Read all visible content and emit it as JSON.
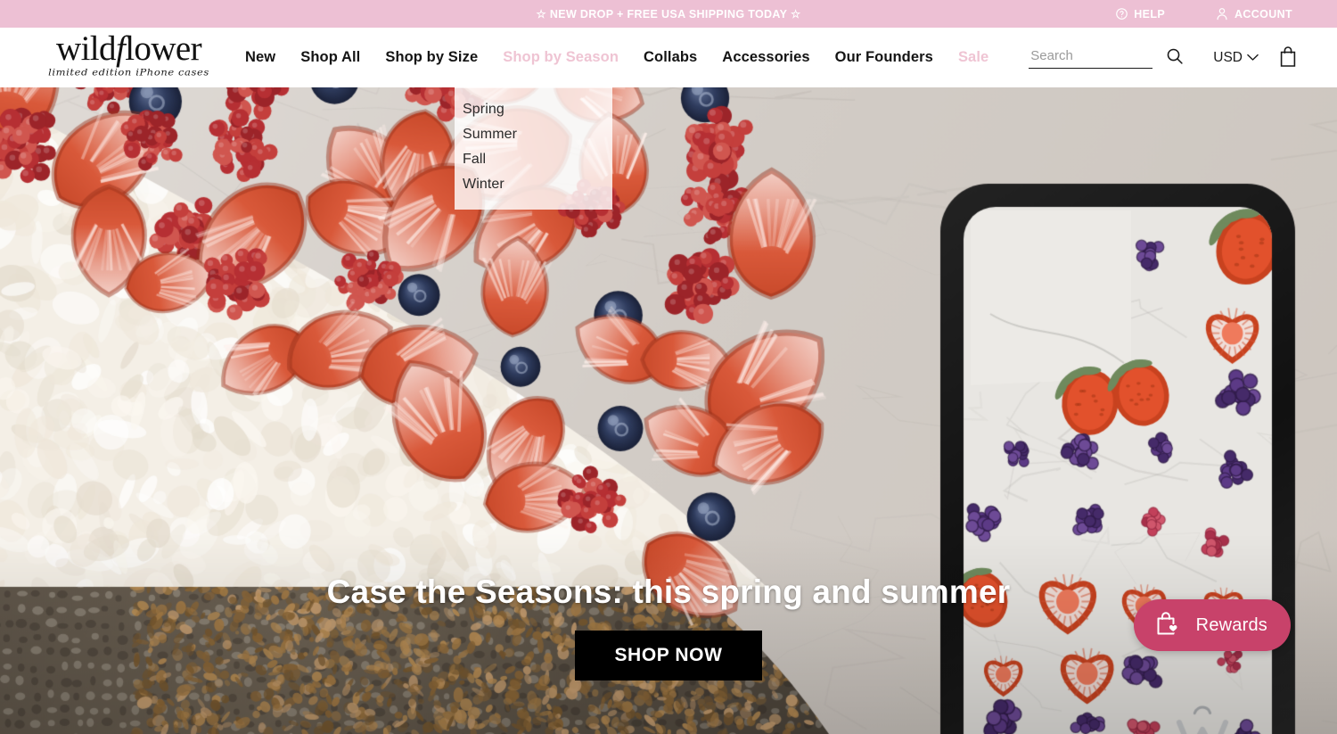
{
  "announcement": {
    "text": "☆ NEW DROP + FREE USA SHIPPING TODAY ☆",
    "background_color": "#EDC0D4",
    "links": [
      {
        "label": "HELP",
        "icon": "help-circle-icon"
      },
      {
        "label": "ACCOUNT",
        "icon": "user-icon"
      }
    ]
  },
  "header": {
    "logo": {
      "word_part1": "wild",
      "word_part2": "f",
      "word_part3": "lower",
      "tagline": "limited edition iPhone cases"
    },
    "nav": [
      {
        "label": "New",
        "state": "default"
      },
      {
        "label": "Shop All",
        "state": "default"
      },
      {
        "label": "Shop by Size",
        "state": "default"
      },
      {
        "label": "Shop by Season",
        "state": "active"
      },
      {
        "label": "Collabs",
        "state": "default"
      },
      {
        "label": "Accessories",
        "state": "default"
      },
      {
        "label": "Our Founders",
        "state": "default"
      },
      {
        "label": "Sale",
        "state": "highlight"
      }
    ],
    "nav_highlight_color": "#EFC4D3",
    "dropdown": {
      "parent": "Shop by Season",
      "items": [
        {
          "label": "Spring"
        },
        {
          "label": "Summer"
        },
        {
          "label": "Fall"
        },
        {
          "label": "Winter"
        }
      ]
    },
    "search": {
      "value": "",
      "placeholder": "Search",
      "icon": "search-icon"
    },
    "currency": {
      "value": "USD",
      "icon": "chevron-down-icon"
    },
    "cart": {
      "icon": "shopping-bag-icon",
      "count": ""
    }
  },
  "hero": {
    "title": "Case the Seasons: this spring and summer",
    "cta_label": "SHOP NOW",
    "cta_background": "#000000",
    "image_description": "Berry fruit tart with sliced strawberries, raspberries and blueberries on whipped cream beside a clear iPhone case with hand-painted berries"
  },
  "rewards_widget": {
    "label": "Rewards",
    "icon": "bag-heart-icon",
    "background_color": "#C8426A",
    "text_color": "#FFFFFF"
  }
}
